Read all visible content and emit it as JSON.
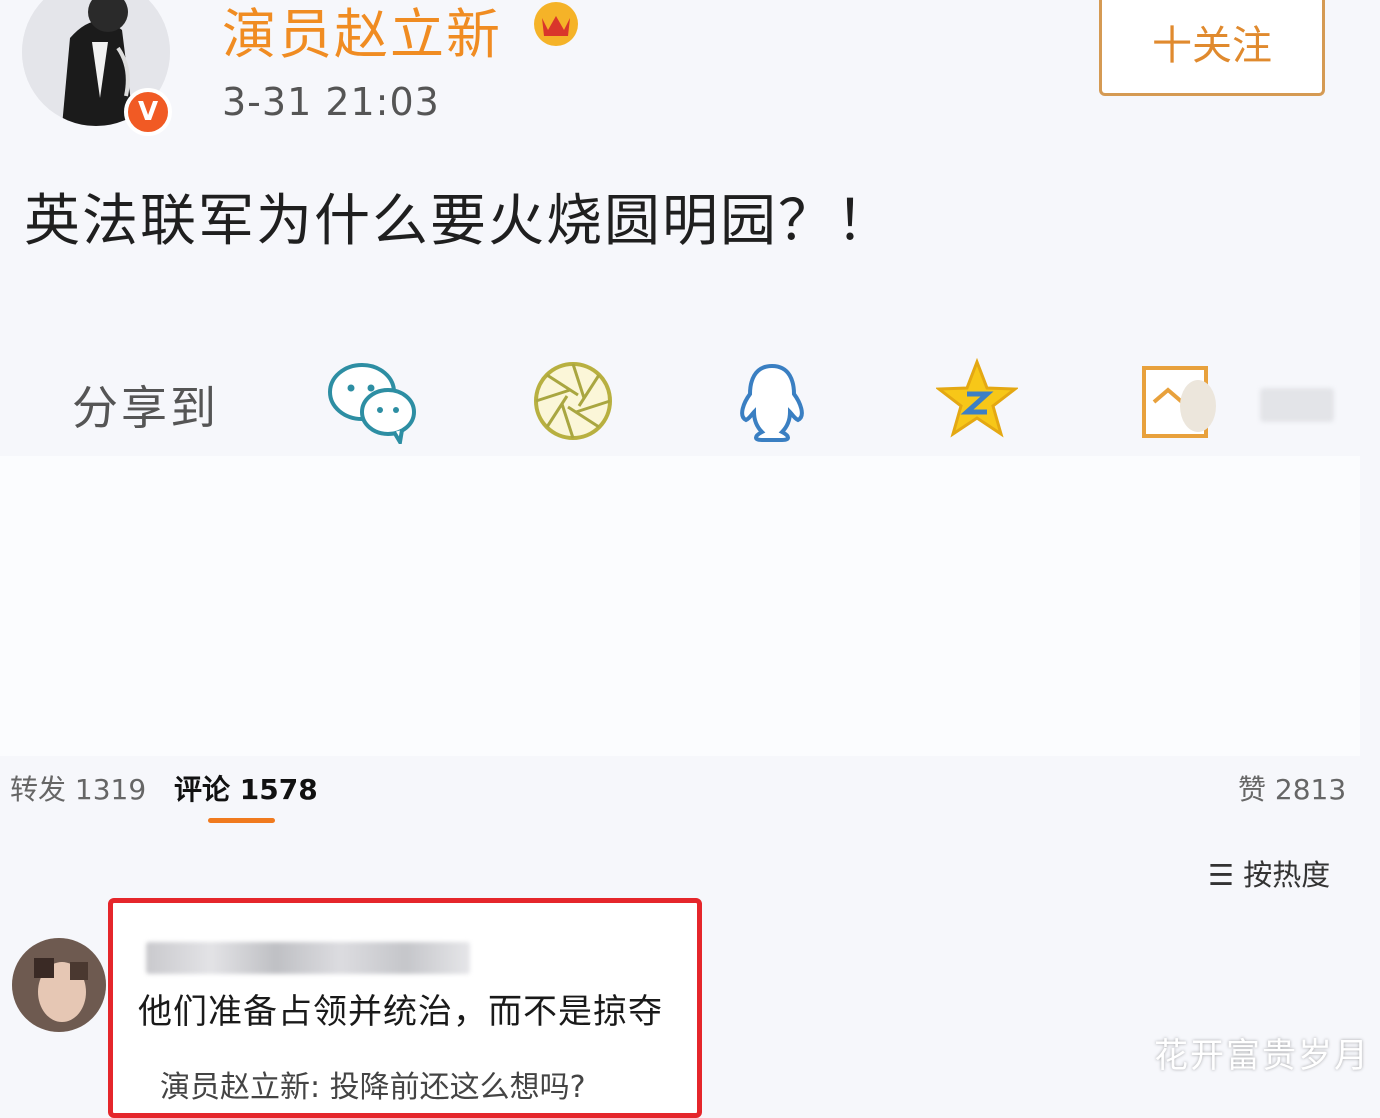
{
  "post": {
    "author_name": "演员赵立新",
    "timestamp": "3-31 21:03",
    "follow_label": "十关注",
    "text": "英法联军为什么要火烧圆明园？！"
  },
  "share": {
    "label": "分享到",
    "targets": [
      "wechat-icon",
      "moments-icon",
      "qq-icon",
      "qzone-icon",
      "more-icon"
    ]
  },
  "tabs": {
    "reposts": "转发 1319",
    "comments": "评论 1578",
    "likes": "赞 2813"
  },
  "sort": {
    "label": "按热度"
  },
  "comment": {
    "text": "他们准备占领并统治，而不是掠夺",
    "reply_preview": "演员赵立新: 投降前还这么想吗?"
  },
  "watermark": "花开富贵岁月",
  "colors": {
    "brand_orange": "#f08c22",
    "highlight_red": "#e5262b",
    "tab_underline": "#f07a1e"
  }
}
